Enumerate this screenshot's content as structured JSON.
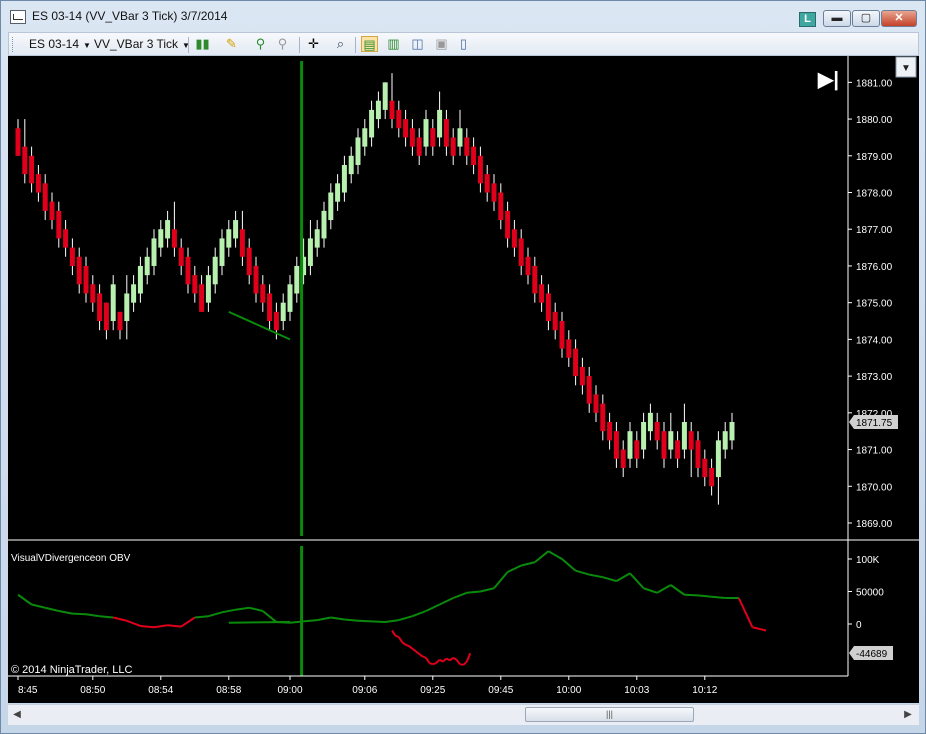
{
  "window": {
    "title": "ES 03-14 (VV_VBar 3 Tick)  3/7/2014",
    "badge": "L",
    "minimize_label": "▬",
    "maximize_label": "▢",
    "close_label": "✕"
  },
  "toolbar": {
    "instrument": "ES 03-14",
    "bar_type": "VV_VBar 3 Tick",
    "icons": [
      "candlestick-style-icon",
      "drawing-pencil-icon",
      "zoom-in-icon",
      "zoom-out-icon",
      "crosshair-icon",
      "search-icon",
      "chart-trader-icon",
      "strategies-icon",
      "indicators-icon",
      "data-box-icon",
      "properties-icon"
    ]
  },
  "chart": {
    "copyright": "© 2014 NinjaTrader, LLC",
    "scroll_end_label": "▶|",
    "menu_label": "▼",
    "colors": {
      "up": "#b8f0b0",
      "down": "#e0001b",
      "wick": "#ffffff",
      "obv_up": "#0a8a0a",
      "obv_down": "#e0001b",
      "divergence": "#0a8a0a",
      "background": "#000000"
    }
  },
  "chart_data": [
    {
      "type": "candlestick",
      "ylim": [
        1868.7,
        1881.5
      ],
      "yticks": [
        "1881.00",
        "1880.00",
        "1879.00",
        "1878.00",
        "1877.00",
        "1876.00",
        "1875.00",
        "1874.00",
        "1873.00",
        "1872.00",
        "1871.00",
        "1870.00",
        "1869.00"
      ],
      "ytick_values": [
        1881,
        1880,
        1879,
        1878,
        1877,
        1876,
        1875,
        1874,
        1873,
        1872,
        1871,
        1870,
        1869
      ],
      "last_price": "1871.75",
      "xticks": [
        "8:45",
        "08:50",
        "08:54",
        "08:58",
        "09:00",
        "09:06",
        "09:25",
        "09:45",
        "10:00",
        "10:03",
        "10:12"
      ],
      "xtick_index": [
        0,
        11,
        21,
        31,
        40,
        51,
        61,
        71,
        81,
        91,
        101
      ],
      "bars": [
        [
          1879.75,
          1879.0,
          1880.0,
          1879.0
        ],
        [
          1879.25,
          1878.5,
          1880.0,
          1878.25
        ],
        [
          1879.0,
          1878.25,
          1879.25,
          1878.0
        ],
        [
          1878.5,
          1878.0,
          1878.75,
          1877.75
        ],
        [
          1878.25,
          1877.5,
          1878.5,
          1877.25
        ],
        [
          1877.75,
          1877.25,
          1878.0,
          1877.0
        ],
        [
          1877.5,
          1876.75,
          1877.75,
          1876.5
        ],
        [
          1877.0,
          1876.5,
          1877.25,
          1876.25
        ],
        [
          1876.5,
          1876.0,
          1876.75,
          1875.75
        ],
        [
          1876.25,
          1875.5,
          1876.5,
          1875.25
        ],
        [
          1876.0,
          1875.25,
          1876.25,
          1875.0
        ],
        [
          1875.5,
          1875.0,
          1875.75,
          1874.75
        ],
        [
          1875.25,
          1874.5,
          1875.5,
          1874.25
        ],
        [
          1875.0,
          1874.25,
          1875.0,
          1874.0
        ],
        [
          1874.5,
          1875.5,
          1875.75,
          1874.25
        ],
        [
          1874.75,
          1874.25,
          1874.75,
          1874.0
        ],
        [
          1874.5,
          1875.25,
          1875.75,
          1874.0
        ],
        [
          1875.0,
          1875.5,
          1875.75,
          1874.75
        ],
        [
          1875.25,
          1876.0,
          1876.25,
          1875.0
        ],
        [
          1875.75,
          1876.25,
          1876.5,
          1875.5
        ],
        [
          1876.0,
          1876.75,
          1877.0,
          1875.75
        ],
        [
          1876.5,
          1877.0,
          1877.25,
          1876.25
        ],
        [
          1876.75,
          1877.25,
          1877.5,
          1876.5
        ],
        [
          1877.0,
          1876.5,
          1877.75,
          1876.25
        ],
        [
          1876.5,
          1876.0,
          1876.75,
          1875.75
        ],
        [
          1876.25,
          1875.5,
          1876.5,
          1875.25
        ],
        [
          1875.75,
          1875.25,
          1876.0,
          1875.0
        ],
        [
          1875.5,
          1874.75,
          1875.75,
          1874.75
        ],
        [
          1875.0,
          1875.75,
          1876.0,
          1874.75
        ],
        [
          1875.5,
          1876.25,
          1876.5,
          1875.25
        ],
        [
          1876.0,
          1876.75,
          1877.0,
          1875.75
        ],
        [
          1876.5,
          1877.0,
          1877.25,
          1876.25
        ],
        [
          1876.75,
          1877.25,
          1877.5,
          1876.5
        ],
        [
          1877.0,
          1876.25,
          1877.5,
          1876.0
        ],
        [
          1876.5,
          1875.75,
          1876.75,
          1875.5
        ],
        [
          1876.0,
          1875.25,
          1876.25,
          1875.0
        ],
        [
          1875.5,
          1875.0,
          1875.75,
          1874.75
        ],
        [
          1875.25,
          1874.5,
          1875.5,
          1874.25
        ],
        [
          1874.75,
          1874.25,
          1875.0,
          1874.0
        ],
        [
          1874.5,
          1875.0,
          1875.25,
          1874.25
        ],
        [
          1874.75,
          1875.5,
          1875.75,
          1874.5
        ],
        [
          1875.25,
          1876.0,
          1876.25,
          1875.0
        ],
        [
          1875.75,
          1876.25,
          1876.75,
          1875.5
        ],
        [
          1876.0,
          1876.75,
          1877.25,
          1875.75
        ],
        [
          1876.5,
          1877.0,
          1877.25,
          1876.25
        ],
        [
          1876.75,
          1877.5,
          1877.75,
          1876.5
        ],
        [
          1877.25,
          1878.0,
          1878.25,
          1877.0
        ],
        [
          1877.75,
          1878.25,
          1878.5,
          1877.5
        ],
        [
          1878.0,
          1878.75,
          1879.0,
          1877.75
        ],
        [
          1878.5,
          1879.0,
          1879.25,
          1878.25
        ],
        [
          1878.75,
          1879.5,
          1879.75,
          1878.5
        ],
        [
          1879.25,
          1879.75,
          1880.0,
          1879.0
        ],
        [
          1879.5,
          1880.25,
          1880.5,
          1879.25
        ],
        [
          1880.0,
          1880.5,
          1880.75,
          1879.75
        ],
        [
          1880.25,
          1881.0,
          1881.0,
          1880.0
        ],
        [
          1880.5,
          1880.0,
          1881.25,
          1879.75
        ],
        [
          1880.25,
          1879.75,
          1880.5,
          1879.5
        ],
        [
          1880.0,
          1879.5,
          1880.25,
          1879.25
        ],
        [
          1879.75,
          1879.25,
          1880.0,
          1879.0
        ],
        [
          1879.5,
          1879.0,
          1879.75,
          1878.75
        ],
        [
          1879.25,
          1880.0,
          1880.25,
          1879.0
        ],
        [
          1879.75,
          1879.25,
          1880.0,
          1879.0
        ],
        [
          1879.5,
          1880.25,
          1880.75,
          1879.25
        ],
        [
          1880.0,
          1879.25,
          1880.25,
          1879.0
        ],
        [
          1879.5,
          1879.0,
          1879.75,
          1878.75
        ],
        [
          1879.25,
          1879.75,
          1880.25,
          1879.0
        ],
        [
          1879.5,
          1879.0,
          1879.75,
          1878.75
        ],
        [
          1879.25,
          1878.75,
          1879.5,
          1878.5
        ],
        [
          1879.0,
          1878.25,
          1879.25,
          1878.0
        ],
        [
          1878.5,
          1878.0,
          1878.75,
          1877.75
        ],
        [
          1878.25,
          1877.75,
          1878.5,
          1877.5
        ],
        [
          1878.0,
          1877.25,
          1878.25,
          1877.0
        ],
        [
          1877.5,
          1876.75,
          1877.75,
          1876.5
        ],
        [
          1877.0,
          1876.5,
          1877.25,
          1876.25
        ],
        [
          1876.75,
          1876.0,
          1877.0,
          1875.75
        ],
        [
          1876.25,
          1875.75,
          1876.5,
          1875.5
        ],
        [
          1876.0,
          1875.25,
          1876.25,
          1875.0
        ],
        [
          1875.5,
          1875.0,
          1875.75,
          1874.75
        ],
        [
          1875.25,
          1874.5,
          1875.5,
          1874.25
        ],
        [
          1874.75,
          1874.25,
          1875.0,
          1874.0
        ],
        [
          1874.5,
          1873.75,
          1874.75,
          1873.5
        ],
        [
          1874.0,
          1873.5,
          1874.25,
          1873.25
        ],
        [
          1873.75,
          1873.0,
          1874.0,
          1872.75
        ],
        [
          1873.25,
          1872.75,
          1873.5,
          1872.5
        ],
        [
          1873.0,
          1872.25,
          1873.25,
          1872.0
        ],
        [
          1872.5,
          1872.0,
          1872.75,
          1871.75
        ],
        [
          1872.25,
          1871.5,
          1872.5,
          1871.25
        ],
        [
          1871.75,
          1871.25,
          1872.0,
          1871.0
        ],
        [
          1871.5,
          1870.75,
          1871.75,
          1870.5
        ],
        [
          1871.0,
          1870.5,
          1871.25,
          1870.25
        ],
        [
          1870.75,
          1871.5,
          1871.75,
          1870.5
        ],
        [
          1871.25,
          1870.75,
          1871.5,
          1870.5
        ],
        [
          1871.0,
          1871.75,
          1872.0,
          1870.75
        ],
        [
          1871.5,
          1872.0,
          1872.25,
          1871.25
        ],
        [
          1871.75,
          1871.25,
          1872.0,
          1871.0
        ],
        [
          1871.5,
          1870.75,
          1871.75,
          1870.5
        ],
        [
          1871.0,
          1871.5,
          1872.0,
          1870.75
        ],
        [
          1871.25,
          1870.75,
          1871.5,
          1870.5
        ],
        [
          1871.0,
          1871.75,
          1872.25,
          1870.75
        ],
        [
          1871.5,
          1871.0,
          1871.75,
          1870.25
        ],
        [
          1871.25,
          1870.5,
          1871.5,
          1870.25
        ],
        [
          1870.75,
          1870.25,
          1871.0,
          1870.0
        ],
        [
          1870.5,
          1870.0,
          1870.75,
          1869.75
        ],
        [
          1870.25,
          1871.25,
          1871.5,
          1869.5
        ],
        [
          1871.0,
          1871.5,
          1871.75,
          1870.75
        ],
        [
          1871.25,
          1871.75,
          1872.0,
          1871.0
        ]
      ],
      "divergence_line": {
        "from": [
          31,
          1874.75
        ],
        "to": [
          40,
          1874.0
        ]
      },
      "marker_index": 42
    },
    {
      "type": "line",
      "title": "VisualVDivergenceon OBV",
      "ylim": [
        -80000,
        120000
      ],
      "yticks": [
        "100K",
        "50000",
        "0"
      ],
      "ytick_values": [
        100000,
        50000,
        0
      ],
      "last_value": "-44689",
      "x": [
        0,
        2,
        4,
        6,
        8,
        10,
        12,
        14,
        16,
        18,
        20,
        22,
        24,
        26,
        28,
        30,
        32,
        34,
        36,
        38,
        40,
        42,
        44,
        46,
        48,
        50,
        52,
        54,
        56,
        58,
        60,
        62,
        64,
        66,
        68,
        70,
        72,
        74,
        76,
        78,
        80,
        82,
        84,
        86,
        88,
        90,
        92,
        94,
        96,
        98,
        100,
        102,
        104,
        106,
        108,
        110
      ],
      "values": [
        45000,
        30000,
        25000,
        20000,
        16000,
        15000,
        12000,
        10000,
        5000,
        -3000,
        -5000,
        -2000,
        -4000,
        10000,
        12000,
        18000,
        22000,
        25000,
        20000,
        3000,
        2000,
        4000,
        6000,
        10000,
        7000,
        5000,
        4000,
        3000,
        6000,
        12000,
        20000,
        30000,
        40000,
        48000,
        50000,
        55000,
        80000,
        90000,
        95000,
        112000,
        100000,
        82000,
        76000,
        72000,
        66000,
        78000,
        55000,
        48000,
        60000,
        45000,
        44000,
        42000,
        40000,
        40000,
        -5000,
        -10000
      ],
      "colors_by_point": "green while rising phases, red in falling/negative phases",
      "divergence_line": {
        "from": [
          19,
          2000
        ],
        "to": [
          35,
          3000
        ]
      },
      "marker_index": 42
    }
  ]
}
